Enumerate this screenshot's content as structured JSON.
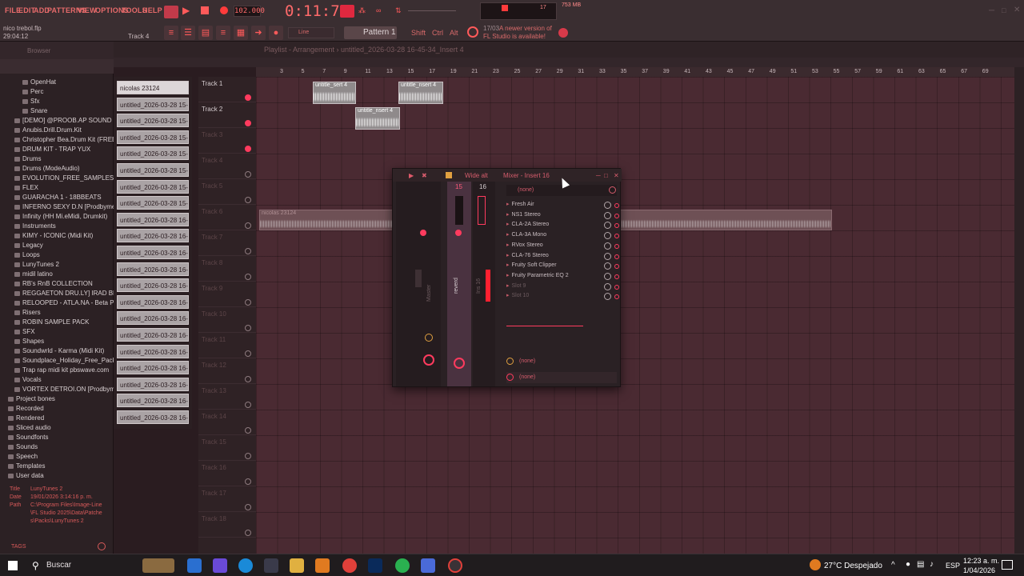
{
  "menu": [
    "FILE",
    "EDIT",
    "ADD",
    "PATTERNS",
    "VIEW",
    "OPTIONS",
    "TOOLS",
    "HELP"
  ],
  "transport": {
    "tempo": "102.000",
    "time": "0:11:76"
  },
  "project": {
    "name": "nico trebol.flp",
    "time": "29:04:12",
    "track": "Track 4"
  },
  "toolbar": {
    "snap": "Line",
    "pattern": "Pattern 1",
    "shift_label": "Shift",
    "ctrl_label": "Ctrl",
    "alt_label": "Alt",
    "update_date": "17/03",
    "update_line1": "A newer version of",
    "update_line2": "FL Studio is available!",
    "cpu": "17",
    "memory": "753 MB"
  },
  "browser": {
    "title": "Browser",
    "items": [
      "OpenHat",
      "Perc",
      "Sfx",
      "Snare",
      "[DEMO] @PROOB.AP SOUND KIT",
      "Anubis.Drill.Drum.Kit",
      "Christopher Bea.Drum Kit (FREE)",
      "DRUM KIT - TRAP YUX",
      "Drums",
      "Drums (ModeAudio)",
      "EVOLUTION_FREE_SAMPLES",
      "FLEX",
      "GUARACHA 1 - 18BBEATS",
      "INFERNO SEXY D.N [Prodbymed]",
      "Infinity (HH Mi.eMidi, Drumkit)",
      "Instruments",
      "KIMY - ICONIC (Midi Kit)",
      "Legacy",
      "Loops",
      "LunyTunes 2",
      "midil latino",
      "RB's RnB COLLECTION",
      "REGGAETON DRU.LY] IRAD BEATS",
      "RELOOPED - ATLA.NA - Beta Pack",
      "Risers",
      "ROBIN SAMPLE PACK",
      "SFX",
      "Shapes",
      "Soundwrld - Karma (Midi Kit)",
      "Soundplace_Holiday_Free_Pack",
      "Trap rap midi kit pbswave.com",
      "Vocals",
      "VORTEX DETROI.ON [Prodbymed]",
      "Project bones",
      "Recorded",
      "Rendered",
      "Sliced audio",
      "Soundfonts",
      "Sounds",
      "Speech",
      "Templates",
      "User data"
    ],
    "info": {
      "title_label": "Title",
      "title_value": "LunyTunes 2",
      "date_label": "Date",
      "date_value": "19/01/2026 3:14:16 p. m.",
      "path_label": "Path",
      "path_value1": "C:\\Program Files\\Image-Line",
      "path_value2": "\\FL Studio 2025\\Data\\Patche",
      "path_value3": "s\\Packs\\LunyTunes 2"
    },
    "tags": "TAGS"
  },
  "playlist": {
    "title": "Playlist - Arrangement › untitled_2026-03-28 16-45-34_Insert 4",
    "samples": [
      "nicolas 23124",
      "untitled_2026-03-28 15-...",
      "untitled_2026-03-28 15-...",
      "untitled_2026-03-28 15-...",
      "untitled_2026-03-28 15-...",
      "untitled_2026-03-28 15-...",
      "untitled_2026-03-28 15-...",
      "untitled_2026-03-28 15-...",
      "untitled_2026-03-28 16-...",
      "untitled_2026-03-28 16-...",
      "untitled_2026-03-28 16-...",
      "untitled_2026-03-28 16-...",
      "untitled_2026-03-28 16-...",
      "untitled_2026-03-28 16-...",
      "untitled_2026-03-28 16-...",
      "untitled_2026-03-28 16-...",
      "untitled_2026-03-28 16-...",
      "untitled_2026-03-28 16-...",
      "untitled_2026-03-28 16-...",
      "untitled_2026-03-28 16-...",
      "untitled_2026-03-28 16-..."
    ],
    "tracks": [
      "Track 1",
      "Track 2",
      "Track 3",
      "Track 4",
      "Track 5",
      "Track 6",
      "Track 7",
      "Track 8",
      "Track 9",
      "Track 10",
      "Track 11",
      "Track 12",
      "Track 13",
      "Track 14",
      "Track 15",
      "Track 16",
      "Track 17",
      "Track 18"
    ],
    "ruler": [
      "3",
      "5",
      "7",
      "9",
      "11",
      "13",
      "15",
      "17",
      "19",
      "21",
      "23",
      "25",
      "27",
      "29",
      "31",
      "33",
      "35",
      "37",
      "39",
      "41",
      "43",
      "45",
      "47",
      "49",
      "51",
      "53",
      "55",
      "57",
      "59",
      "61",
      "63",
      "65",
      "67",
      "69"
    ],
    "clips": {
      "c1": "untitle_sert 4",
      "c2": "untitle_nsert 4",
      "c3": "untitle_nsert 4",
      "c4": "nicolas 23124"
    }
  },
  "mixer": {
    "title": "Mixer - Insert 16",
    "preset": "Wide alt",
    "none": "(none)",
    "strip_numbers": [
      "15",
      "16"
    ],
    "strip_labels": [
      "Master",
      "reverd",
      "Ins 16"
    ],
    "slots": [
      "Fresh Air",
      "NS1 Stereo",
      "CLA-2A Stereo",
      "CLA-3A Mono",
      "RVox Stereo",
      "CLA-76 Stereo",
      "Fruity Soft Clipper",
      "Fruity Parametric EQ 2",
      "Slot 9",
      "Slot 10"
    ],
    "out_none": "(none)",
    "in_none": "(none)"
  },
  "taskbar": {
    "search": "Buscar",
    "weather": "27°C Despejado",
    "lang": "ESP",
    "time": "12:23 a. m.",
    "date": "1/04/2026"
  }
}
